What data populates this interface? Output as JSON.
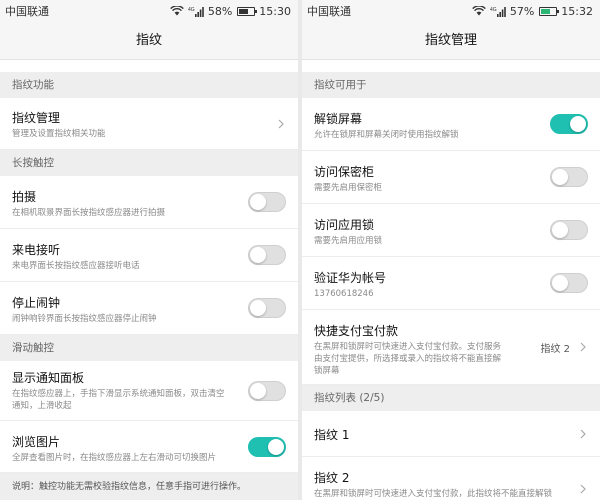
{
  "left": {
    "status": {
      "carrier": "中国联通",
      "network": "4G",
      "battery": "58%",
      "battery_level": 0.58,
      "time": "15:30"
    },
    "title": "指纹",
    "sections": [
      {
        "header": "指纹功能"
      },
      {
        "header": "长按触控"
      },
      {
        "header": "滑动触控"
      }
    ],
    "items": {
      "manage": {
        "label": "指纹管理",
        "sub": "管理及设置指纹相关功能"
      },
      "capture": {
        "label": "拍摄",
        "sub": "在相机取景界面长按指纹感应器进行拍摄",
        "on": false
      },
      "answer": {
        "label": "来电接听",
        "sub": "来电界面长按指纹感应器接听电话",
        "on": false
      },
      "alarm": {
        "label": "停止闹钟",
        "sub": "闹钟响铃界面长按指纹感应器停止闹钟",
        "on": false
      },
      "notify": {
        "label": "显示通知面板",
        "sub": "在指纹感应器上，手指下滑显示系统通知面板，双击清空通知，上滑收起",
        "on": false
      },
      "browse": {
        "label": "浏览图片",
        "sub": "全屏查看图片时，在指纹感应器上左右滑动可切换图片",
        "on": true
      }
    },
    "footnote": "说明：触控功能无需校验指纹信息，任意手指可进行操作。"
  },
  "right": {
    "status": {
      "carrier": "中国联通",
      "network": "4G",
      "battery": "57%",
      "battery_level": 0.57,
      "time": "15:32"
    },
    "title": "指纹管理",
    "sections": [
      {
        "header": "指纹可用于"
      },
      {
        "header": "指纹列表 (2/5)"
      }
    ],
    "items": {
      "unlock": {
        "label": "解锁屏幕",
        "sub": "允许在锁屏和屏幕关闭时使用指纹解锁",
        "on": true
      },
      "safe": {
        "label": "访问保密柜",
        "sub": "需要先启用保密柜",
        "on": false
      },
      "applock": {
        "label": "访问应用锁",
        "sub": "需要先启用应用锁",
        "on": false
      },
      "huawei": {
        "label": "验证华为帐号",
        "sub": "13760618246",
        "on": false
      },
      "alipay": {
        "label": "快捷支付宝付款",
        "sub": "在黑屏和锁屏时可快速进入支付宝付款。支付服务由支付宝提供，所选择或录入的指纹将不能直接解锁屏幕",
        "value": "指纹 2"
      },
      "fp1": {
        "label": "指纹 1"
      },
      "fp2": {
        "label": "指纹 2",
        "sub": "在黑屏和锁屏时可快速进入支付宝付款，此指纹将不能直接解锁屏幕"
      }
    }
  },
  "colors": {
    "accent": "#1fbfb1",
    "section_bg": "#eeeeee",
    "row_bg": "#ffffff"
  },
  "icons": [
    "wifi-icon",
    "signal-icon",
    "battery-icon",
    "chevron-right-icon"
  ]
}
